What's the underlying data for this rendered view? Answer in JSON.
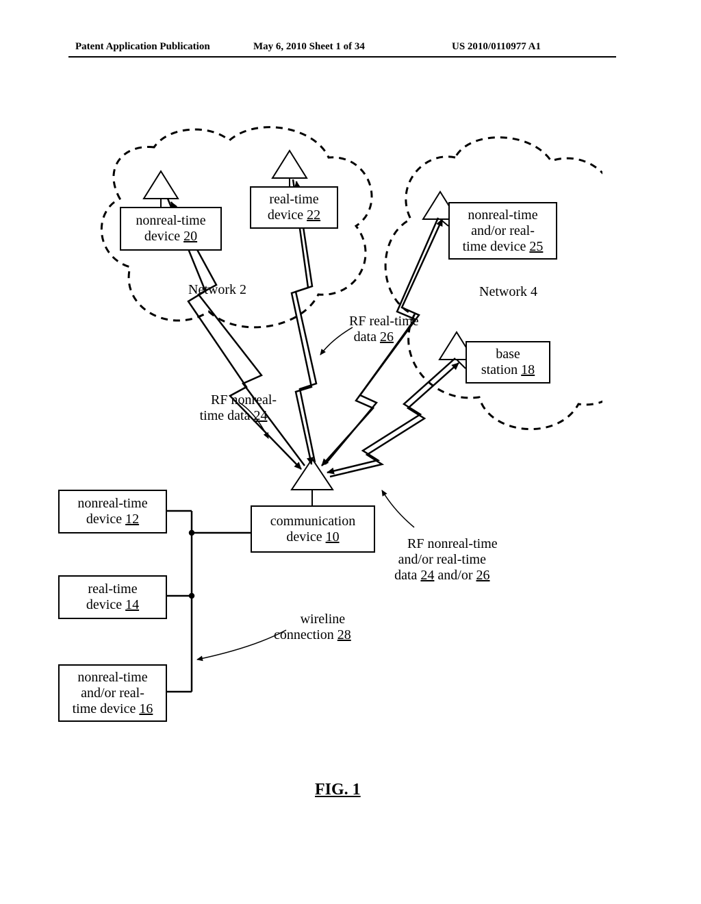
{
  "header": {
    "left": "Patent Application Publication",
    "center": "May 6, 2010  Sheet 1 of 34",
    "right": "US 2010/0110977 A1"
  },
  "figure": {
    "caption": "FIG. 1",
    "network2_label": "Network 2",
    "network4_label": "Network 4",
    "boxes": {
      "nonreal20": "nonreal-time\ndevice ",
      "nonreal20_num": "20",
      "real22": "real-time\ndevice ",
      "real22_num": "22",
      "nrt25": "nonreal-time\nand/or real-\ntime device ",
      "nrt25_num": "25",
      "base18": "base\nstation ",
      "base18_num": "18",
      "comm10": "communication\ndevice ",
      "comm10_num": "10",
      "nrt12": "nonreal-time\ndevice ",
      "nrt12_num": "12",
      "rt14": "real-time\ndevice ",
      "rt14_num": "14",
      "nrt16": "nonreal-time\nand/or real-\ntime device ",
      "nrt16_num": "16"
    },
    "labels": {
      "rf_nrt24": "RF nonreal-\ntime data ",
      "rf_nrt24_num": "24",
      "rf_rt26": "RF real-time\ndata ",
      "rf_rt26_num": "26",
      "rf_mix": "RF nonreal-time\nand/or real-time\ndata ",
      "rf_mix_num1": "24",
      "rf_mix_join": " and/or ",
      "rf_mix_num2": "26",
      "wireline28": "wireline\nconnection ",
      "wireline28_num": "28"
    }
  }
}
